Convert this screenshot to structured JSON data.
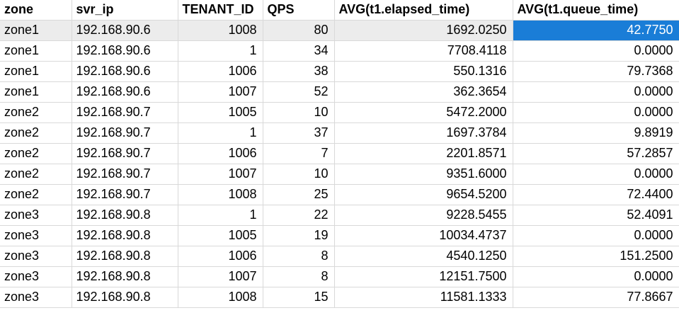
{
  "columns": [
    "zone",
    "svr_ip",
    "TENANT_ID",
    "QPS",
    "AVG(t1.elapsed_time)",
    "AVG(t1.queue_time)"
  ],
  "rows": [
    [
      "zone1",
      "192.168.90.6",
      "1008",
      "80",
      "1692.0250",
      "42.7750"
    ],
    [
      "zone1",
      "192.168.90.6",
      "1",
      "34",
      "7708.4118",
      "0.0000"
    ],
    [
      "zone1",
      "192.168.90.6",
      "1006",
      "38",
      "550.1316",
      "79.7368"
    ],
    [
      "zone1",
      "192.168.90.6",
      "1007",
      "52",
      "362.3654",
      "0.0000"
    ],
    [
      "zone2",
      "192.168.90.7",
      "1005",
      "10",
      "5472.2000",
      "0.0000"
    ],
    [
      "zone2",
      "192.168.90.7",
      "1",
      "37",
      "1697.3784",
      "9.8919"
    ],
    [
      "zone2",
      "192.168.90.7",
      "1006",
      "7",
      "2201.8571",
      "57.2857"
    ],
    [
      "zone2",
      "192.168.90.7",
      "1007",
      "10",
      "9351.6000",
      "0.0000"
    ],
    [
      "zone2",
      "192.168.90.7",
      "1008",
      "25",
      "9654.5200",
      "72.4400"
    ],
    [
      "zone3",
      "192.168.90.8",
      "1",
      "22",
      "9228.5455",
      "52.4091"
    ],
    [
      "zone3",
      "192.168.90.8",
      "1005",
      "19",
      "10034.4737",
      "0.0000"
    ],
    [
      "zone3",
      "192.168.90.8",
      "1006",
      "8",
      "4540.1250",
      "151.2500"
    ],
    [
      "zone3",
      "192.168.90.8",
      "1007",
      "8",
      "12151.7500",
      "0.0000"
    ],
    [
      "zone3",
      "192.168.90.8",
      "1008",
      "15",
      "11581.1333",
      "77.8667"
    ]
  ],
  "selection": {
    "row": 0,
    "col": 5
  },
  "colors": {
    "selection": "#1a7dd7",
    "current_row": "#ececec",
    "grid_line": "#d9d9d9"
  }
}
